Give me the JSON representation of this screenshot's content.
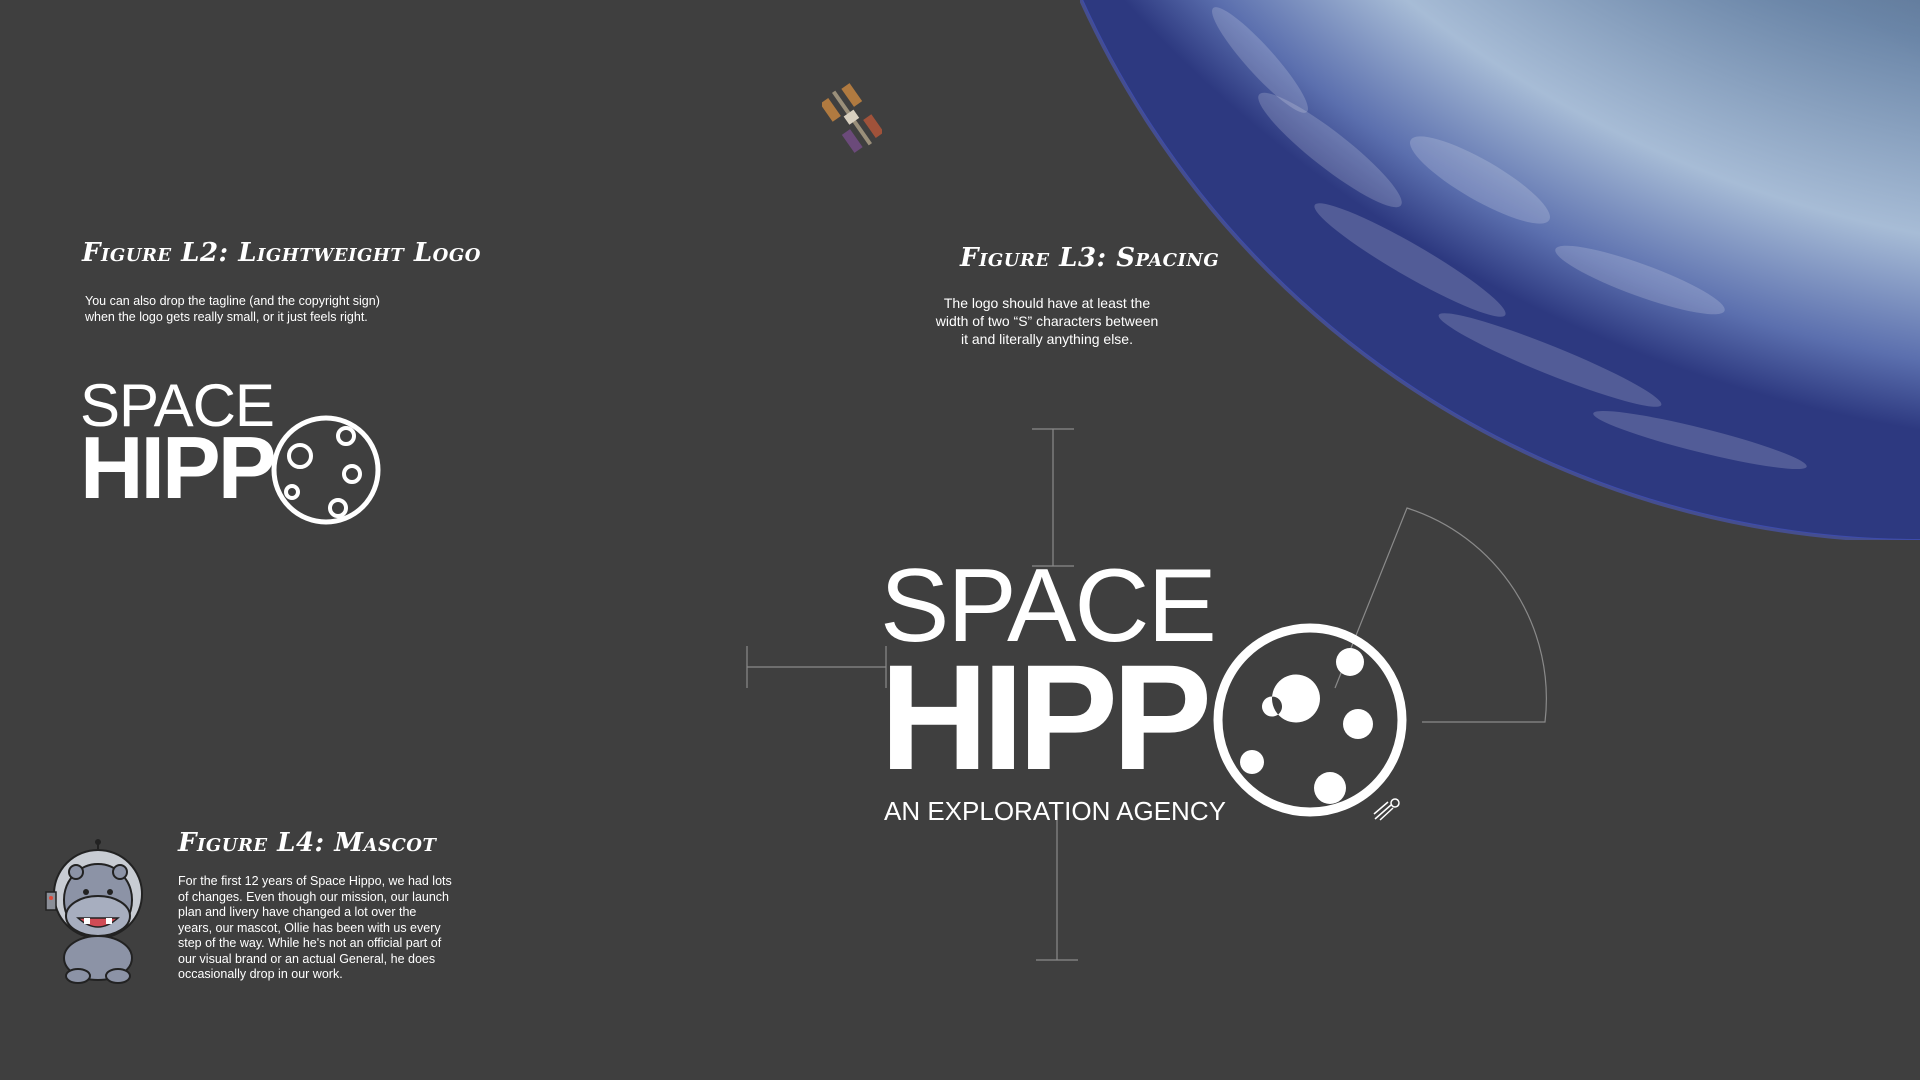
{
  "figure_l2": {
    "heading": "Figure L2: Lightweight Logo",
    "body_line1": "You can also drop the tagline (and the copyright sign)",
    "body_line2": "when the logo gets really small, or it just feels right."
  },
  "figure_l3": {
    "heading": "Figure L3: Spacing",
    "body_line1": "The logo should have at least the",
    "body_line2": "width of two “S” characters between",
    "body_line3": "it and literally anything else."
  },
  "figure_l4": {
    "heading": "Figure L4: Mascot",
    "lines": [
      "For the first 12 years of Space Hippo, we had lots",
      "of changes. Even though our mission, our launch",
      "plan and livery have changed a lot over the",
      "years, our mascot,  Ollie has been with us every",
      "step of the way. While he's not an official part of",
      "our visual brand or an actual General,  he does",
      "occasionally drop in our work."
    ]
  },
  "logo_small": {
    "space": "SPACE",
    "hippo": "HIPP"
  },
  "logo_main": {
    "space": "SPACE",
    "hippo": "HIPP",
    "tagline": "AN EXPLORATION AGENCY"
  },
  "colors": {
    "background": "#3f3f3f",
    "text": "#ffffff",
    "guide_lines": "#8a8a8a"
  },
  "icons": [
    "earth-image",
    "space-station-icon",
    "moon-o-icon",
    "rocket-trail-icon",
    "hippo-mascot-icon"
  ]
}
